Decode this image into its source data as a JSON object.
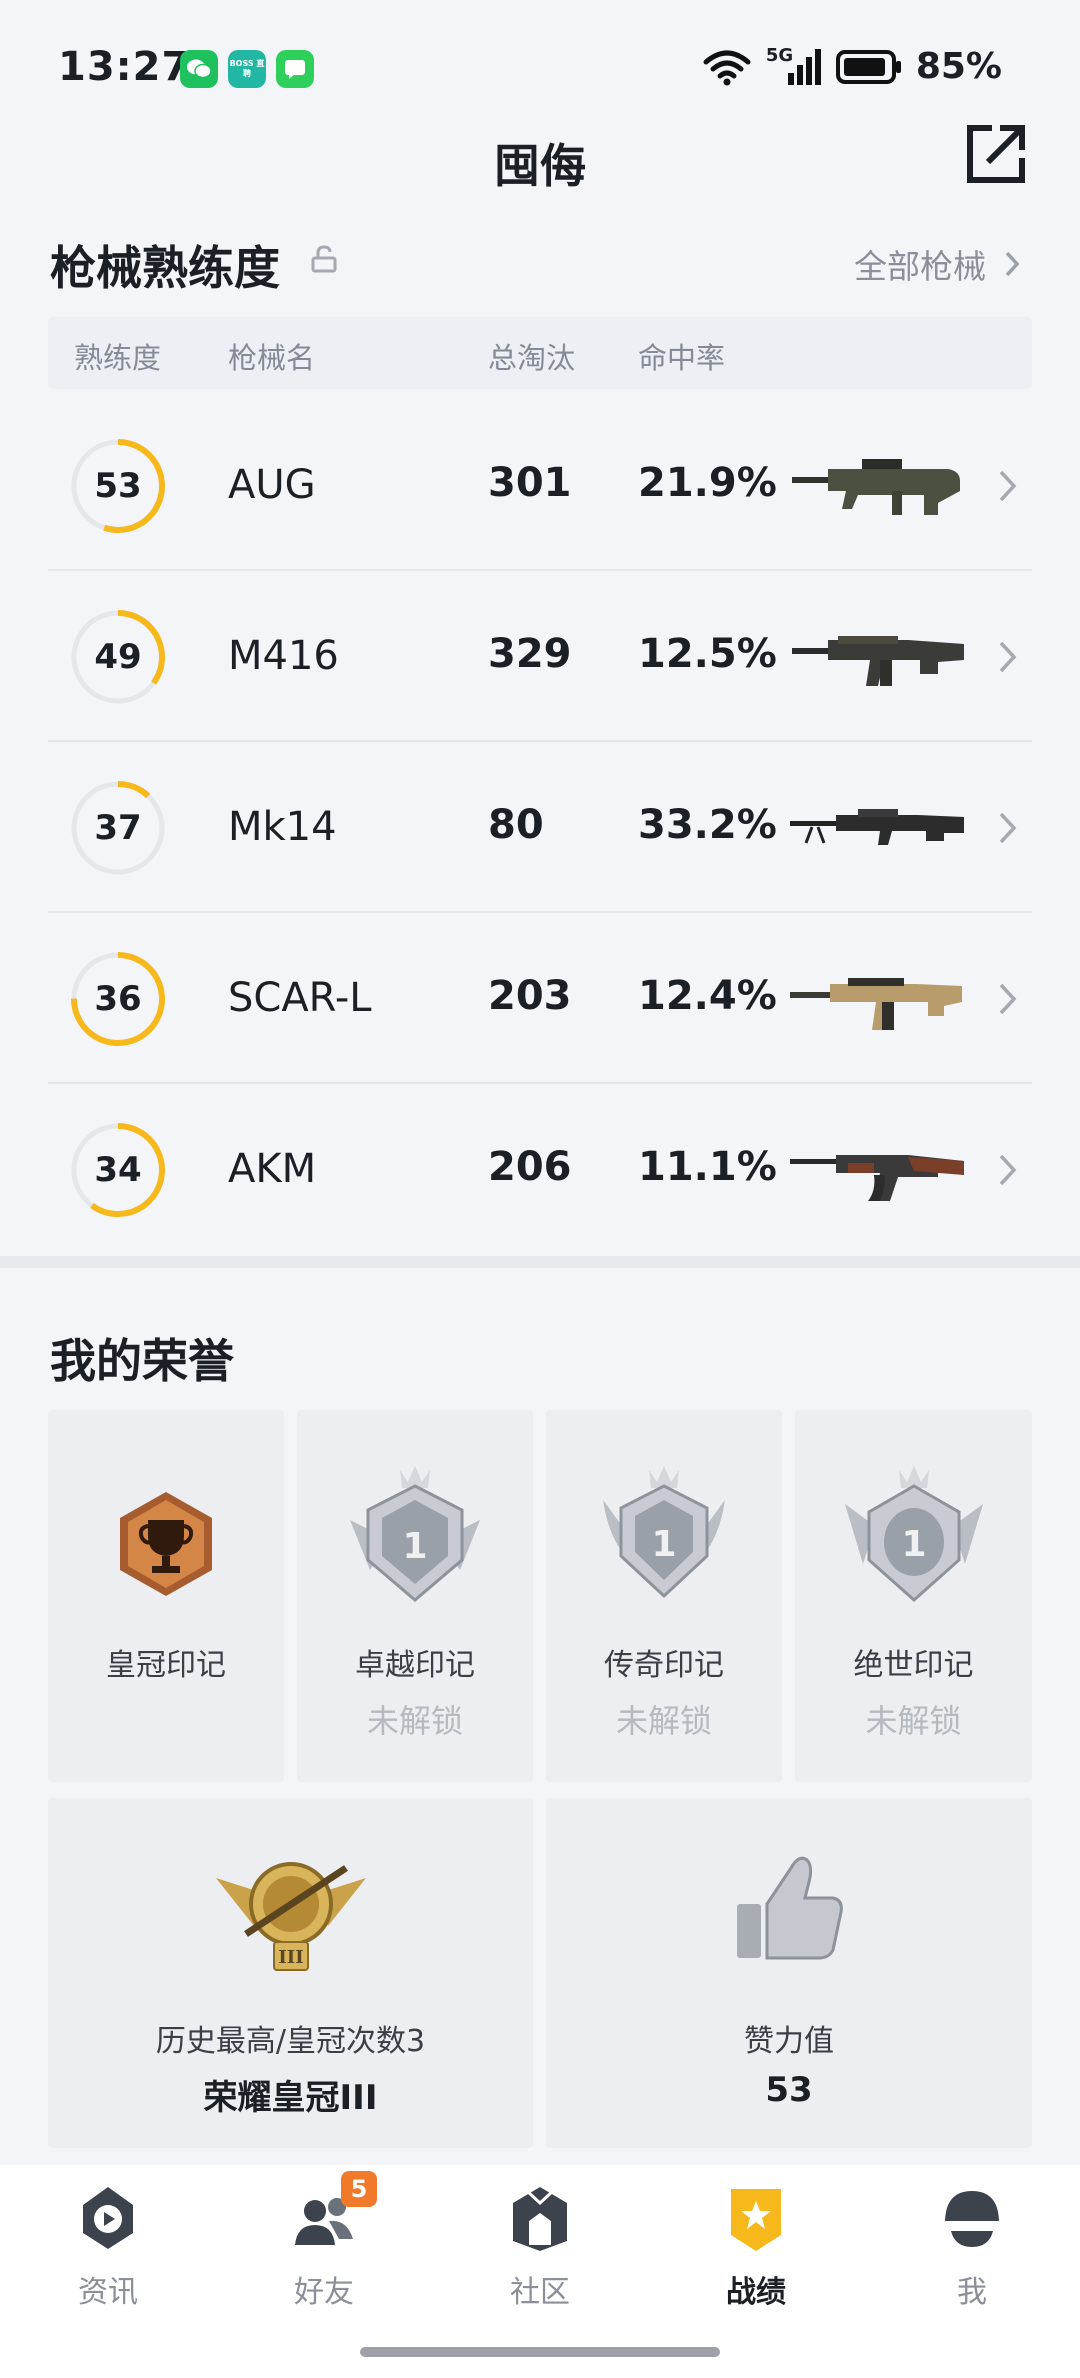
{
  "status": {
    "time": "13:27",
    "battery": "85%",
    "network": "5G",
    "app_icons": [
      "wechat-icon",
      "boss-zhipin-icon",
      "message-icon"
    ],
    "boss_label": "BOSS 直聘"
  },
  "header": {
    "title": "囤侮"
  },
  "weapons": {
    "title": "枪械熟练度",
    "all_link": "全部枪械",
    "columns": {
      "proficiency": "熟练度",
      "name": "枪械名",
      "kills": "总淘汰",
      "accuracy": "命中率"
    },
    "items": [
      {
        "level": "53",
        "progress": 0.55,
        "name": "AUG",
        "kills": "301",
        "accuracy": "21.9%",
        "gun_icon": "aug-rifle-icon"
      },
      {
        "level": "49",
        "progress": 0.35,
        "name": "M416",
        "kills": "329",
        "accuracy": "12.5%",
        "gun_icon": "m416-rifle-icon"
      },
      {
        "level": "37",
        "progress": 0.12,
        "name": "Mk14",
        "kills": "80",
        "accuracy": "33.2%",
        "gun_icon": "mk14-rifle-icon"
      },
      {
        "level": "36",
        "progress": 0.75,
        "name": "SCAR-L",
        "kills": "203",
        "accuracy": "12.4%",
        "gun_icon": "scar-l-rifle-icon"
      },
      {
        "level": "34",
        "progress": 0.6,
        "name": "AKM",
        "kills": "206",
        "accuracy": "11.1%",
        "gun_icon": "akm-rifle-icon"
      }
    ],
    "ring_color": "#f7b81c"
  },
  "honors": {
    "title": "我的荣誉",
    "marks": [
      {
        "name": "皇冠印记",
        "status": ""
      },
      {
        "name": "卓越印记",
        "status": "未解锁"
      },
      {
        "name": "传奇印记",
        "status": "未解锁"
      },
      {
        "name": "绝世印记",
        "status": "未解锁"
      }
    ],
    "highest": {
      "label": "历史最高/皇冠次数3",
      "value": "荣耀皇冠III",
      "tier_numeral": "III"
    },
    "likes": {
      "label": "赞力值",
      "value": "53"
    },
    "mark_numeral": "1"
  },
  "nav": {
    "items": [
      {
        "label": "资讯",
        "icon": "news-play-icon"
      },
      {
        "label": "好友",
        "icon": "friends-icon",
        "badge": "5"
      },
      {
        "label": "社区",
        "icon": "community-icon"
      },
      {
        "label": "战绩",
        "icon": "record-medal-icon",
        "active": true
      },
      {
        "label": "我",
        "icon": "helmet-profile-icon"
      }
    ],
    "active_color": "#f7b81c"
  }
}
